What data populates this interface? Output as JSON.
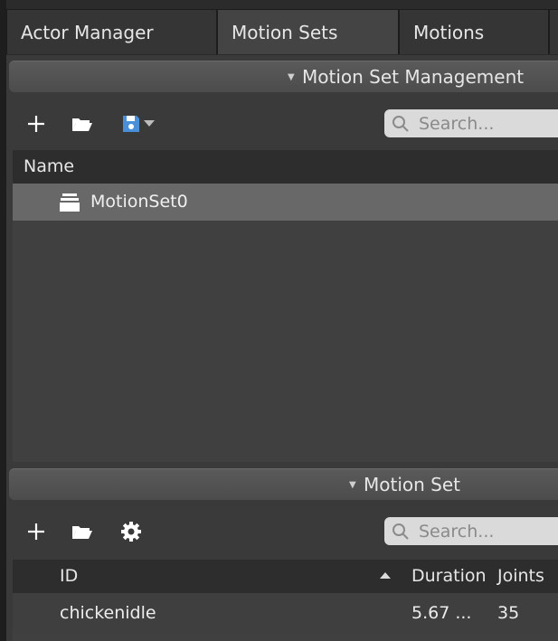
{
  "tabs": [
    {
      "label": "Actor Manager"
    },
    {
      "label": "Motion Sets",
      "active": true
    },
    {
      "label": "Motions"
    }
  ],
  "motion_set_management": {
    "title": "Motion Set Management",
    "toolbar": {
      "icons": [
        "add-icon",
        "open-folder-icon",
        "save-icon",
        "dropdown-arrow-icon"
      ]
    },
    "search": {
      "placeholder": "Search..."
    },
    "list": {
      "header": "Name",
      "items": [
        {
          "label": "MotionSet0",
          "icon": "motion-set-icon",
          "selected": true
        }
      ]
    }
  },
  "motion_set": {
    "title": "Motion Set",
    "toolbar": {
      "icons": [
        "add-icon",
        "open-folder-icon",
        "gear-icon"
      ]
    },
    "search": {
      "placeholder": "Search..."
    },
    "table": {
      "columns": [
        "ID",
        "Duration",
        "Joints"
      ],
      "sort_column": "ID",
      "rows": [
        {
          "id": "chickenidle",
          "duration": "5.67 ...",
          "joints": "35"
        }
      ]
    }
  },
  "colors": {
    "background": "#3a3a3a",
    "selected_row": "#686868",
    "accent_save": "#4a90d9"
  }
}
